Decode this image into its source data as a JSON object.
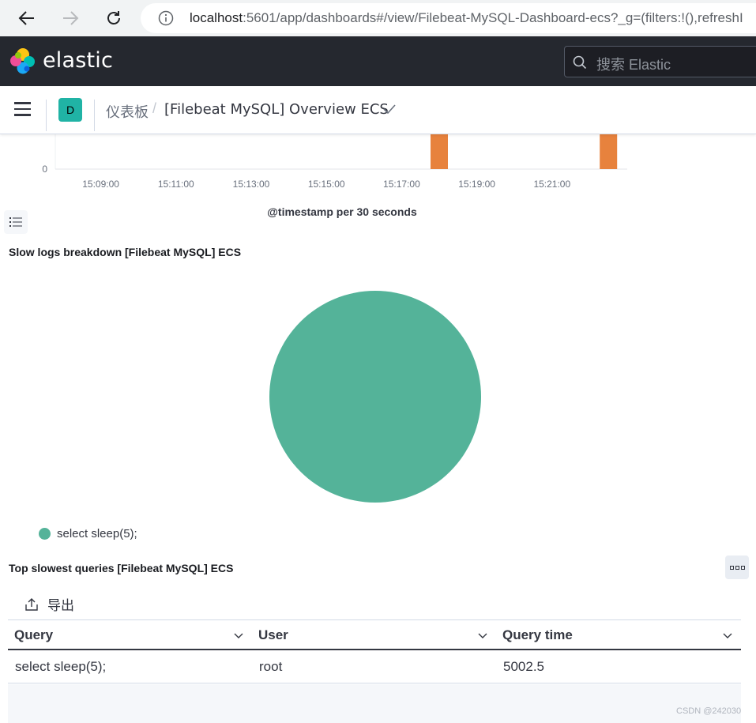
{
  "browser": {
    "url_host": "localhost",
    "url_rest": ":5601/app/dashboards#/view/Filebeat-MySQL-Dashboard-ecs?_g=(filters:!(),refreshI"
  },
  "header": {
    "brand": "elastic",
    "search_placeholder": "搜索 Elastic"
  },
  "subheader": {
    "space_initial": "D",
    "breadcrumb_parent": "仪表板",
    "breadcrumb_separator": "/",
    "breadcrumb_current": "[Filebeat MySQL] Overview ECS"
  },
  "histogram": {
    "xlabel": "@timestamp per 30 seconds",
    "y_tick": "0"
  },
  "chart_data": [
    {
      "type": "bar",
      "x_ticks": [
        "15:09:00",
        "15:11:00",
        "15:13:00",
        "15:15:00",
        "15:17:00",
        "15:19:00",
        "15:21:00"
      ],
      "x": [
        "15:18:00",
        "15:22:30"
      ],
      "xlim": [
        "15:08:00",
        "15:23:00"
      ],
      "values": [
        1,
        1
      ],
      "xlabel": "@timestamp per 30 seconds",
      "y_tick_labels": [
        "0"
      ],
      "color": "#e7823d"
    },
    {
      "type": "pie",
      "title": "Slow logs breakdown [Filebeat MySQL] ECS",
      "categories": [
        "select sleep(5);"
      ],
      "values": [
        1
      ],
      "colors": [
        "#54b399"
      ],
      "legend": "bottom-left"
    }
  ],
  "pie_panel": {
    "title": "Slow logs breakdown [Filebeat MySQL] ECS",
    "legend_label": "select sleep(5);"
  },
  "table_panel": {
    "title": "Top slowest queries [Filebeat MySQL] ECS",
    "export_label": "导出",
    "columns": [
      "Query",
      "User",
      "Query time"
    ],
    "rows": [
      [
        "select sleep(5);",
        "root",
        "5002.5"
      ]
    ]
  },
  "watermark": "CSDN @242030",
  "colors": {
    "header_bg": "#25282f",
    "accent_green": "#54b399",
    "bar_orange": "#e7823d",
    "space_badge": "#20b3a5"
  }
}
